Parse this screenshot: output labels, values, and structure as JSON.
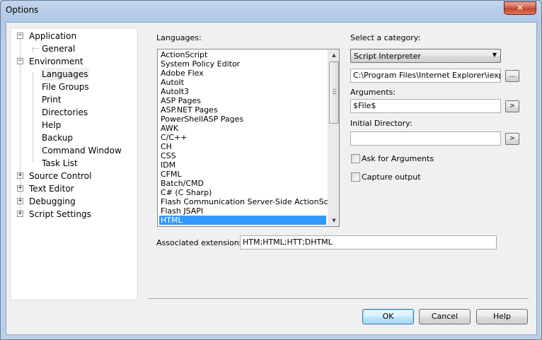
{
  "window": {
    "title": "Options",
    "close_glyph": "✕"
  },
  "tree": {
    "items": [
      {
        "label": "Application",
        "expander": "−"
      },
      {
        "label": "General"
      },
      {
        "label": "Environment",
        "expander": "−"
      },
      {
        "label": "Languages"
      },
      {
        "label": "File Groups"
      },
      {
        "label": "Print"
      },
      {
        "label": "Directories"
      },
      {
        "label": "Help"
      },
      {
        "label": "Backup"
      },
      {
        "label": "Command Window"
      },
      {
        "label": "Task List"
      },
      {
        "label": "Source Control",
        "expander": "+"
      },
      {
        "label": "Text Editor",
        "expander": "+"
      },
      {
        "label": "Debugging",
        "expander": "+"
      },
      {
        "label": "Script Settings",
        "expander": "+"
      }
    ]
  },
  "languages": {
    "label": "Languages:",
    "items": [
      "ActionScript",
      "System Policy Editor",
      "Adobe Flex",
      "AutoIt",
      "AutoIt3",
      "ASP Pages",
      "ASP.NET Pages",
      "PowerShellASP Pages",
      "AWK",
      "C/C++",
      "CH",
      "CSS",
      "IDM",
      "CFML",
      "Batch/CMD",
      "C# (C Sharp)",
      "Flash Communication Server-Side ActionScript",
      "Flash JSAPI",
      "HTML"
    ],
    "selected": "HTML"
  },
  "category": {
    "label": "Select a category:",
    "value": "Script Interpreter",
    "path_value": "C:\\Program Files\\Internet Explorer\\iexplore.exe",
    "browse_label": "...",
    "arguments_label": "Arguments:",
    "arguments_value": "$File$",
    "arrow_label": ">",
    "initial_dir_label": "Initial Directory:",
    "initial_dir_value": "",
    "ask_args_label": "Ask for Arguments",
    "ask_args_checked": false,
    "capture_output_label": "Capture output",
    "capture_output_checked": false
  },
  "extensions": {
    "label": "Associated extensions:",
    "value": "HTM;HTML;HTT;DHTML"
  },
  "buttons": {
    "ok": "OK",
    "cancel": "Cancel",
    "help": "Help"
  },
  "icons": {
    "scroll_up": "up-arrow-icon",
    "scroll_down": "down-arrow-icon",
    "combo_arrow": "dropdown-arrow-icon"
  }
}
